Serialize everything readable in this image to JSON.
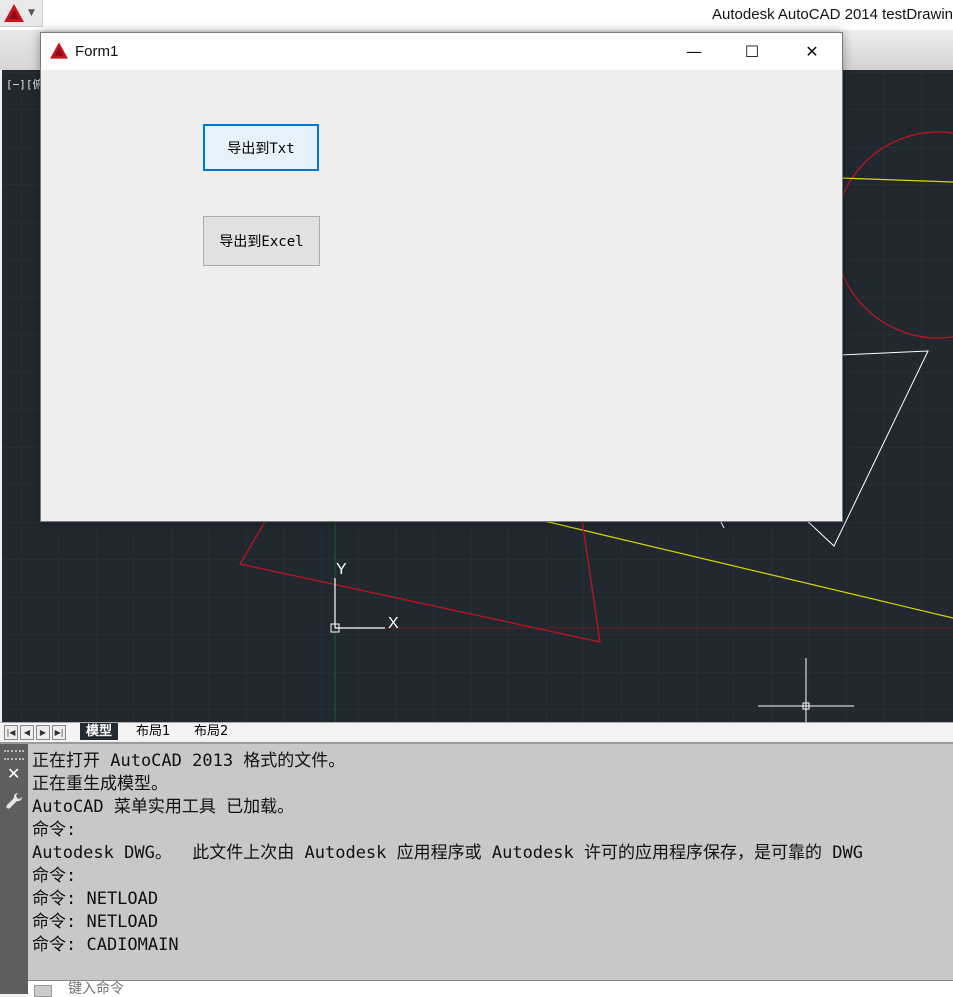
{
  "app": {
    "title": "Autodesk AutoCAD 2014    testDrawin",
    "viewport_label": "[−][俯视"
  },
  "form1": {
    "title": "Form1",
    "buttons": {
      "export_txt": "导出到Txt",
      "export_excel": "导出到Excel"
    },
    "window_controls": {
      "minimize": "—",
      "maximize": "☐",
      "close": "✕"
    }
  },
  "layout_tabs": {
    "model": "模型",
    "layout1": "布局1",
    "layout2": "布局2"
  },
  "command_window": {
    "history": [
      "正在打开 AutoCAD 2013 格式的文件。",
      "正在重生成模型。",
      "AutoCAD 菜单实用工具 已加载。",
      "命令:",
      "Autodesk DWG。  此文件上次由 Autodesk 应用程序或 Autodesk 许可的应用程序保存，是可靠的 DWG",
      "命令:",
      "命令: NETLOAD",
      "命令: NETLOAD",
      "命令: CADIOMAIN"
    ],
    "input_placeholder": "键入命令"
  },
  "colors": {
    "canvas": "#212830",
    "accent_focus": "#0078d7",
    "red_entity": "#c8141e",
    "yellow_entity": "#d8d800",
    "white_entity": "#ffffff"
  },
  "ucs": {
    "x_label": "X",
    "y_label": "Y"
  }
}
